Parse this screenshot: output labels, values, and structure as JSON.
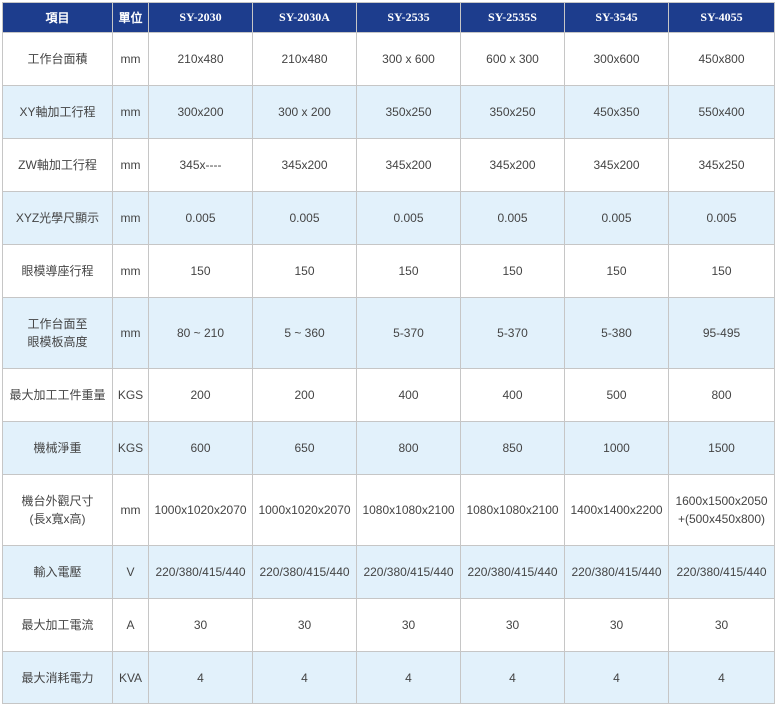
{
  "header": [
    "項目",
    "單位",
    "SY-2030",
    "SY-2030A",
    "SY-2535",
    "SY-2535S",
    "SY-3545",
    "SY-4055"
  ],
  "rows": [
    {
      "label": [
        "工作台面積"
      ],
      "unit": "mm",
      "values": [
        [
          "210x480"
        ],
        [
          "210x480"
        ],
        [
          "300 x 600"
        ],
        [
          "600 x 300"
        ],
        [
          "300x600"
        ],
        [
          "450x800"
        ]
      ]
    },
    {
      "label": [
        "XY軸加工行程"
      ],
      "unit": "mm",
      "values": [
        [
          "300x200"
        ],
        [
          "300 x 200"
        ],
        [
          "350x250"
        ],
        [
          "350x250"
        ],
        [
          "450x350"
        ],
        [
          "550x400"
        ]
      ]
    },
    {
      "label": [
        "ZW軸加工行程"
      ],
      "unit": "mm",
      "values": [
        [
          "345x----"
        ],
        [
          "345x200"
        ],
        [
          "345x200"
        ],
        [
          "345x200"
        ],
        [
          "345x200"
        ],
        [
          "345x250"
        ]
      ]
    },
    {
      "label": [
        "XYZ光學尺顯示"
      ],
      "unit": "mm",
      "values": [
        [
          "0.005"
        ],
        [
          "0.005"
        ],
        [
          "0.005"
        ],
        [
          "0.005"
        ],
        [
          "0.005"
        ],
        [
          "0.005"
        ]
      ]
    },
    {
      "label": [
        "眼模導座行程"
      ],
      "unit": "mm",
      "values": [
        [
          "150"
        ],
        [
          "150"
        ],
        [
          "150"
        ],
        [
          "150"
        ],
        [
          "150"
        ],
        [
          "150"
        ]
      ]
    },
    {
      "label": [
        "工作台面至",
        "眼模板高度"
      ],
      "unit": "mm",
      "values": [
        [
          "80 ~ 210"
        ],
        [
          "5 ~ 360"
        ],
        [
          "5-370"
        ],
        [
          "5-370"
        ],
        [
          "5-380"
        ],
        [
          "95-495"
        ]
      ]
    },
    {
      "label": [
        "最大加工工件重量"
      ],
      "unit": "KGS",
      "values": [
        [
          "200"
        ],
        [
          "200"
        ],
        [
          "400"
        ],
        [
          "400"
        ],
        [
          "500"
        ],
        [
          "800"
        ]
      ]
    },
    {
      "label": [
        "機械淨重"
      ],
      "unit": "KGS",
      "values": [
        [
          "600"
        ],
        [
          "650"
        ],
        [
          "800"
        ],
        [
          "850"
        ],
        [
          "1000"
        ],
        [
          "1500"
        ]
      ]
    },
    {
      "label": [
        "機台外觀尺寸",
        "(長x寬x高)"
      ],
      "unit": "mm",
      "values": [
        [
          "1000x1020x2070"
        ],
        [
          "1000x1020x2070"
        ],
        [
          "1080x1080x2100"
        ],
        [
          "1080x1080x2100"
        ],
        [
          "1400x1400x2200"
        ],
        [
          "1600x1500x2050",
          "+(500x450x800)"
        ]
      ]
    },
    {
      "label": [
        "輸入電壓"
      ],
      "unit": "V",
      "values": [
        [
          "220/380/415/440"
        ],
        [
          "220/380/415/440"
        ],
        [
          "220/380/415/440"
        ],
        [
          "220/380/415/440"
        ],
        [
          "220/380/415/440"
        ],
        [
          "220/380/415/440"
        ]
      ]
    },
    {
      "label": [
        "最大加工電流"
      ],
      "unit": "A",
      "values": [
        [
          "30"
        ],
        [
          "30"
        ],
        [
          "30"
        ],
        [
          "30"
        ],
        [
          "30"
        ],
        [
          "30"
        ]
      ]
    },
    {
      "label": [
        "最大消耗電力"
      ],
      "unit": "KVA",
      "values": [
        [
          "4"
        ],
        [
          "4"
        ],
        [
          "4"
        ],
        [
          "4"
        ],
        [
          "4"
        ],
        [
          "4"
        ]
      ]
    }
  ]
}
